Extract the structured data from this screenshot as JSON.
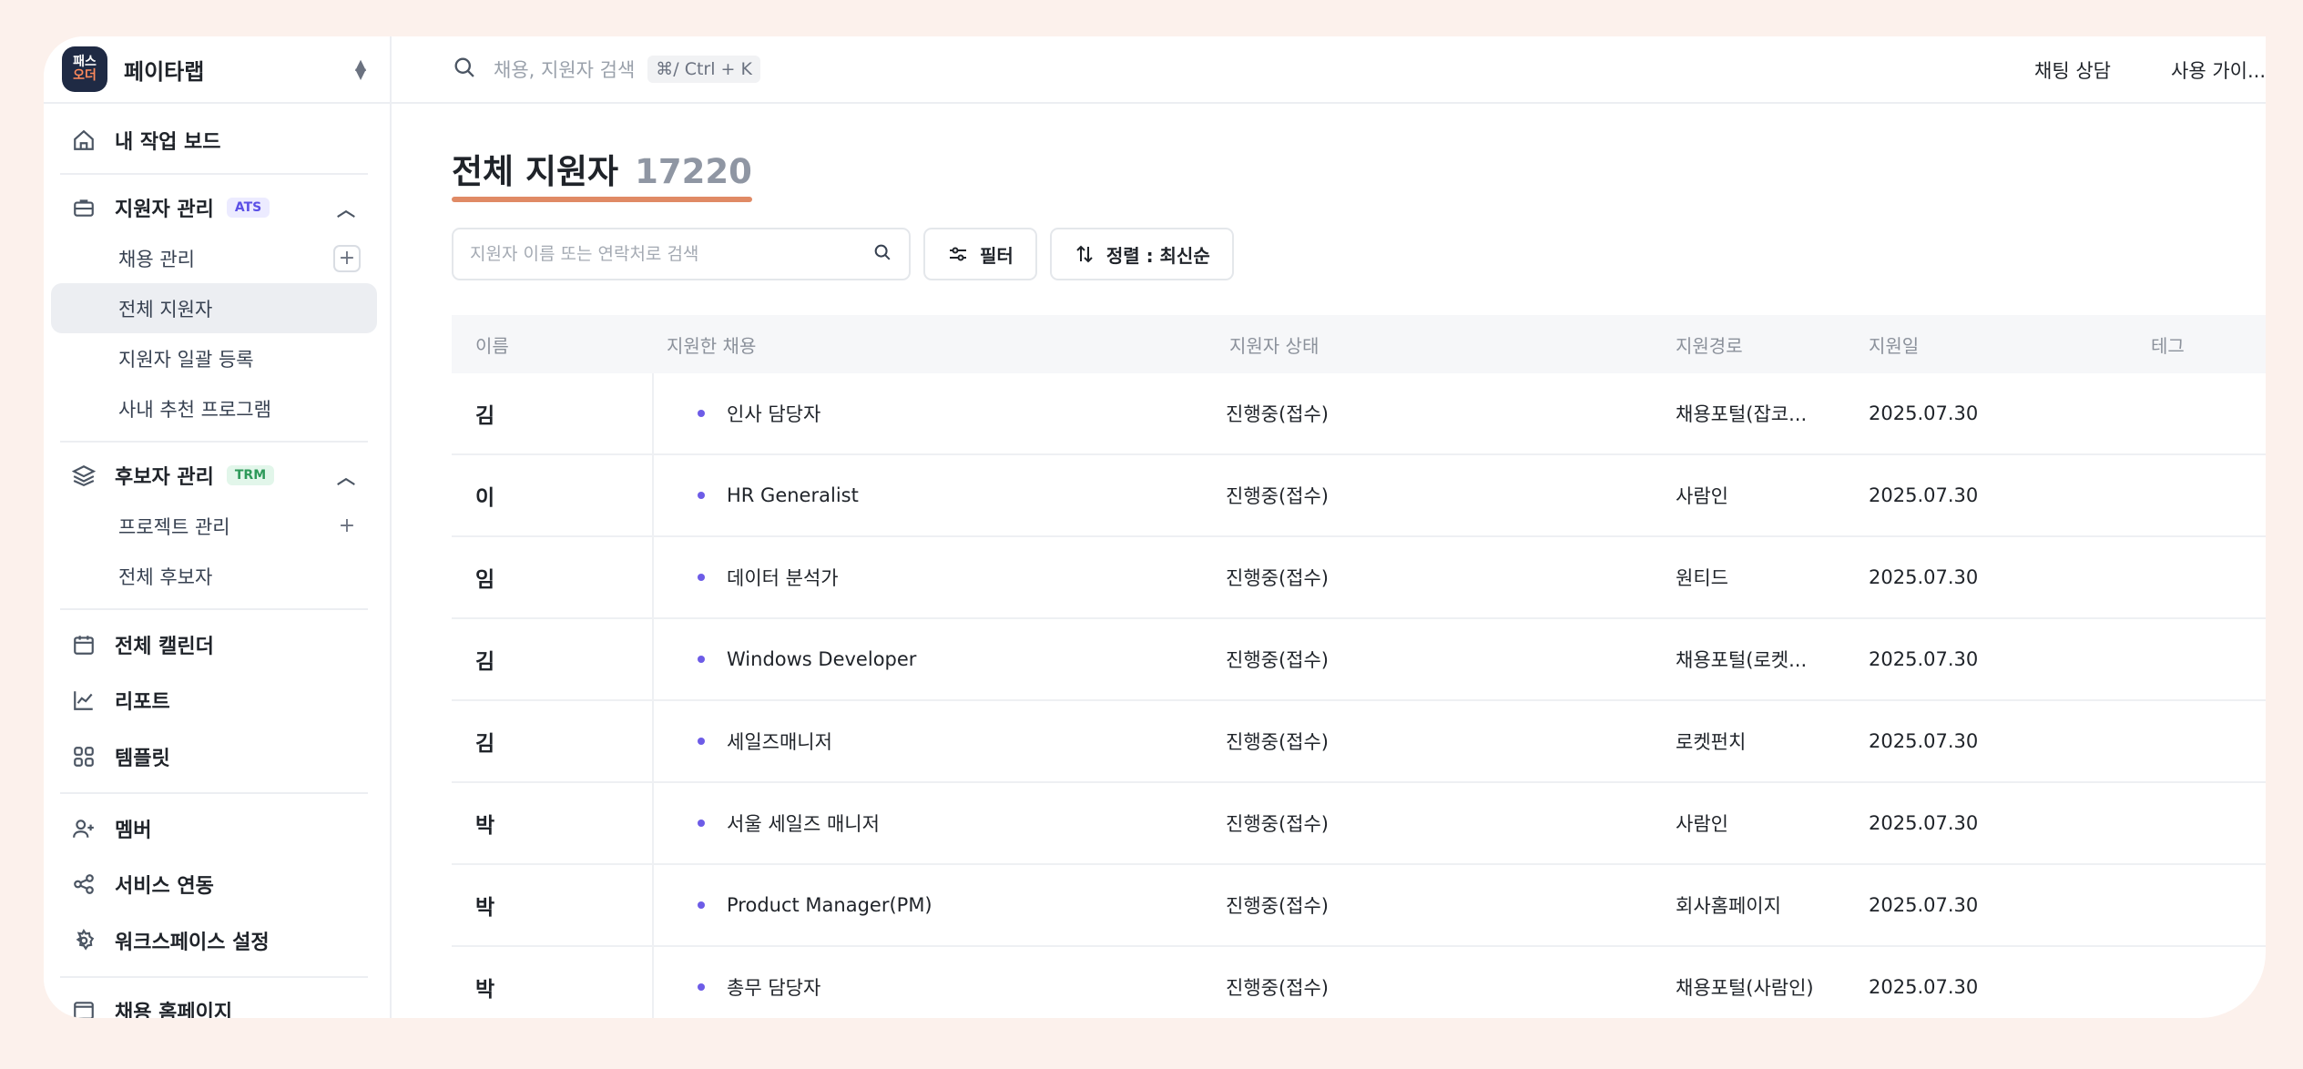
{
  "workspace": {
    "logo_top": "패스",
    "logo_bottom": "오더",
    "name": "페이타랩"
  },
  "nav": {
    "my_board": "내 작업 보드",
    "applicant_mgmt": {
      "label": "지원자 관리",
      "badge": "ATS"
    },
    "recruit_mgmt": "채용 관리",
    "all_applicants": "전체 지원자",
    "bulk_register": "지원자 일괄 등록",
    "referral": "사내 추천 프로그램",
    "candidate_mgmt": {
      "label": "후보자 관리",
      "badge": "TRM"
    },
    "project_mgmt": "프로젝트 관리",
    "all_candidates": "전체 후보자",
    "calendar": "전체 캘린더",
    "report": "리포트",
    "template": "템플릿",
    "member": "멤버",
    "integration": "서비스 연동",
    "settings": "워크스페이스 설정",
    "homepage": "채용 홈페이지"
  },
  "topbar": {
    "search_placeholder": "채용, 지원자 검색",
    "shortcut": "⌘/ Ctrl + K",
    "chat": "채팅 상담",
    "guide": "사용 가이..."
  },
  "page": {
    "title": "전체 지원자",
    "count": "17220"
  },
  "toolbar": {
    "search_placeholder": "지원자 이름 또는 연락처로 검색",
    "filter": "필터",
    "sort": "정렬 : 최신순"
  },
  "table": {
    "headers": {
      "name": "이름",
      "job": "지원한 채용",
      "status": "지원자 상태",
      "source": "지원경로",
      "date": "지원일",
      "tag": "테그"
    },
    "rows": [
      {
        "name": "김",
        "job": "인사 담당자",
        "status": "진행중(접수)",
        "source": "채용포털(잡코...",
        "date": "2025.07.30"
      },
      {
        "name": "이",
        "job": "HR Generalist",
        "status": "진행중(접수)",
        "source": "사람인",
        "date": "2025.07.30"
      },
      {
        "name": "임",
        "job": "데이터 분석가",
        "status": "진행중(접수)",
        "source": "원티드",
        "date": "2025.07.30"
      },
      {
        "name": "김",
        "job": "Windows Developer",
        "status": "진행중(접수)",
        "source": "채용포털(로켓...",
        "date": "2025.07.30"
      },
      {
        "name": "김",
        "job": "세일즈매니저",
        "status": "진행중(접수)",
        "source": "로켓펀치",
        "date": "2025.07.30"
      },
      {
        "name": "박",
        "job": "서울 세일즈 매니저",
        "status": "진행중(접수)",
        "source": "사람인",
        "date": "2025.07.30"
      },
      {
        "name": "박",
        "job": "Product Manager(PM)",
        "status": "진행중(접수)",
        "source": "회사홈페이지",
        "date": "2025.07.30"
      },
      {
        "name": "박",
        "job": "총무 담당자",
        "status": "진행중(접수)",
        "source": "채용포털(사람인)",
        "date": "2025.07.30"
      }
    ]
  },
  "colors": {
    "accent_underline": "#e08a65",
    "job_dot": "#6d5ce7",
    "ats_badge": "#5b50e6",
    "trm_badge": "#2e9a5a"
  }
}
